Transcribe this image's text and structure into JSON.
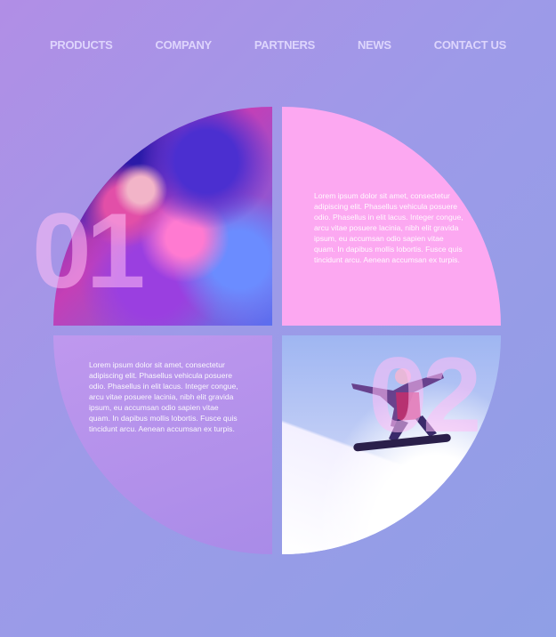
{
  "nav": {
    "items": [
      "PRODUCTS",
      "COMPANY",
      "PARTNERS",
      "NEWS",
      "CONTACT US"
    ]
  },
  "sections": {
    "first": {
      "number": "01",
      "text": "Lorem ipsum dolor sit amet, consectetur adipiscing elit. Phasellus vehicula posuere odio. Phasellus in elit lacus. Integer congue, arcu vitae posuere lacinia, nibh elit gravida ipsum, eu accumsan odio sapien vitae quam. In dapibus mollis lobortis. Fusce quis tincidunt arcu. Aenean accumsan ex turpis."
    },
    "second": {
      "number": "02",
      "text": "Lorem ipsum dolor sit amet, consectetur adipiscing elit. Phasellus vehicula posuere odio. Phasellus in elit lacus. Integer congue, arcu vitae posuere lacinia, nibh elit gravida ipsum, eu accumsan odio sapien vitae quam. In dapibus mollis lobortis. Fusce quis tincidunt arcu. Aenean accumsan ex turpis."
    }
  },
  "colors": {
    "background_start": "#b18ee6",
    "background_end": "#8f9fe6",
    "pink_panel": "#fca8f1",
    "number_overlay": "#ffbef5"
  }
}
